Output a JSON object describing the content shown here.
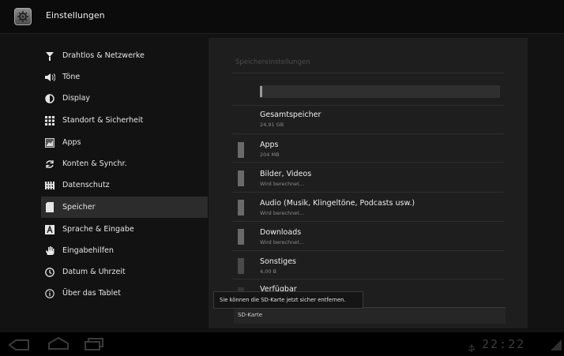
{
  "header": {
    "title": "Einstellungen",
    "app_icon": "settings-app-icon"
  },
  "sidebar": {
    "selected_index": 8,
    "items": [
      {
        "label": "Drahtlos & Netzwerke",
        "icon": "wireless-icon"
      },
      {
        "label": "Töne",
        "icon": "speaker-icon"
      },
      {
        "label": "Display",
        "icon": "brightness-icon"
      },
      {
        "label": "Standort & Sicherheit",
        "icon": "location-grid-icon"
      },
      {
        "label": "Apps",
        "icon": "apps-icon"
      },
      {
        "label": "Konten & Synchr.",
        "icon": "sync-icon"
      },
      {
        "label": "Datenschutz",
        "icon": "privacy-icon"
      },
      {
        "label": "Speicher",
        "icon": "storage-icon"
      },
      {
        "label": "Sprache & Eingabe",
        "icon": "language-icon"
      },
      {
        "label": "Eingabehilfen",
        "icon": "hand-icon"
      },
      {
        "label": "Datum & Uhrzeit",
        "icon": "clock-icon"
      },
      {
        "label": "Über das Tablet",
        "icon": "info-icon"
      }
    ]
  },
  "storage": {
    "header": "Speichereinstellungen",
    "usage_fraction": 0.01,
    "total": {
      "label": "Gesamtspeicher",
      "value": "24,91 GB"
    },
    "rows": [
      {
        "label": "Apps",
        "value": "204 MB"
      },
      {
        "label": "Bilder, Videos",
        "value": "Wird berechnet..."
      },
      {
        "label": "Audio (Musik, Klingeltöne, Podcasts usw.)",
        "value": "Wird berechnet..."
      },
      {
        "label": "Downloads",
        "value": "Wird berechnet..."
      },
      {
        "label": "Sonstiges",
        "value": "4,00 B"
      }
    ],
    "available": {
      "label": "Verfügbar"
    },
    "sd_section": "SD-Karte"
  },
  "toast": {
    "text": "Sie können die SD-Karte jetzt sicher entfernen."
  },
  "statusbar": {
    "clock": "22:22"
  }
}
